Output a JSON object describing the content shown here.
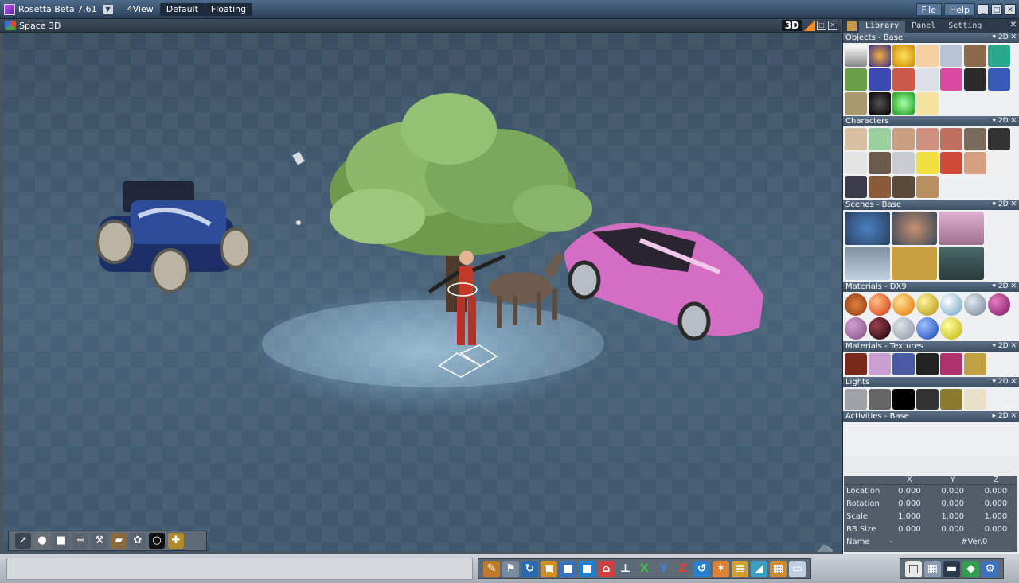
{
  "app": {
    "title": "Rosetta Beta 7.61",
    "menus": [
      "4View",
      "Default",
      "Floating"
    ],
    "right_menus": [
      "File",
      "Help"
    ],
    "window_buttons": [
      "_",
      "□",
      "✕"
    ]
  },
  "viewport": {
    "label": "Space 3D",
    "mode": "3D"
  },
  "panel": {
    "tabs": [
      "Library",
      "Panel",
      "Setting"
    ],
    "sections": {
      "objects": "Objects - Base",
      "characters": "Characters",
      "scenes": "Scenes - Base",
      "materials_dx9": "Materials - DX9",
      "materials_textures": "Materials - Textures",
      "lights": "Lights",
      "activities": "Activities - Base"
    },
    "section_ctrl": "2D",
    "properties": {
      "headers": [
        "X",
        "Y",
        "Z"
      ],
      "rows": [
        {
          "label": "Location",
          "x": "0.000",
          "y": "0.000",
          "z": "0.000"
        },
        {
          "label": "Rotation",
          "x": "0.000",
          "y": "0.000",
          "z": "0.000"
        },
        {
          "label": "Scale",
          "x": "1.000",
          "y": "1.000",
          "z": "1.000"
        },
        {
          "label": "BB Size",
          "x": "0.000",
          "y": "0.000",
          "z": "0.000"
        }
      ],
      "name_label": "Name",
      "name_dash": "-",
      "name_value": "#Ver.0"
    }
  },
  "bottom_axes": [
    "X",
    "Y",
    "Z"
  ]
}
